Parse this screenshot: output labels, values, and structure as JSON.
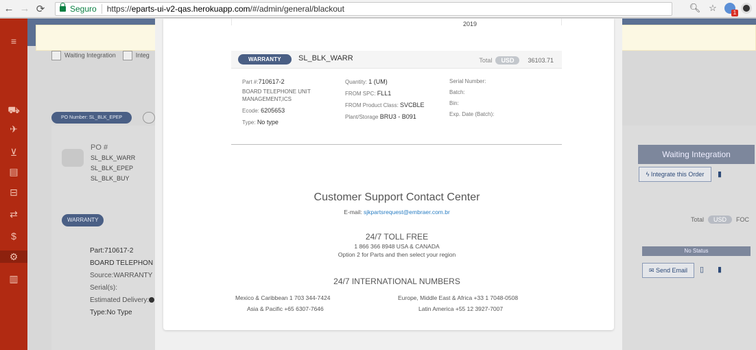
{
  "browser": {
    "secure_label": "Seguro",
    "url_prefix": "https://",
    "url_host": "eparts-ui-v2-qas.herokuapp.com",
    "url_path": "/#/admin/general/blackout",
    "ext_badge": "1"
  },
  "background": {
    "filters": [
      "Waiting Integration",
      "Integ"
    ],
    "po_chip": "PO Number: SL_BLK_EPEP",
    "po_title": "PO #",
    "po_numbers": [
      "SL_BLK_WARR",
      "SL_BLK_EPEP",
      "SL_BLK_BUY"
    ],
    "status_button": "Waiting Integration",
    "integrate_button": "Integrate this Order",
    "warranty_chip": "WARRANTY",
    "total_label": "Total",
    "currency": "USD",
    "foc": "FOC",
    "part_lines": [
      "Part:710617-2",
      "BOARD TELEPHON",
      "Source:WARRANTY",
      "Serial(s):",
      "Estimated Delivery:",
      "Type:No Type"
    ],
    "no_status": "No Status",
    "send_email": "Send Email"
  },
  "modal": {
    "year": "2019",
    "item": {
      "warranty_chip": "WARRANTY",
      "code": "SL_BLK_WARR",
      "total_label": "Total",
      "currency": "USD",
      "total_value": "36103.71",
      "part_label": "Part #:",
      "part_value": "710617-2",
      "description": "BOARD TELEPHONE UNIT MANAGEMENT,ICS",
      "ecode_label": "Ecode:",
      "ecode_value": "6205653",
      "type_label": "Type:",
      "type_value": "No type",
      "quantity_label": "Quantity:",
      "quantity_value": "1 (UM)",
      "from_spc_label": "FROM SPC:",
      "from_spc_value": "FLL1",
      "from_class_label": "FROM Product Class:",
      "from_class_value": "SVCBLE",
      "plant_label": "Plant/Storage",
      "plant_value": "BRU3 - B091",
      "serial_label": "Serial Number:",
      "batch_label": "Batch:",
      "bin_label": "Bin:",
      "exp_label": "Exp. Date (Batch):"
    },
    "support": {
      "title": "Customer Support Contact Center",
      "email_label": "E-mail:",
      "email": "sjkpartsrequest@embraer.com.br",
      "tollfree_title": "24/7 TOLL FREE",
      "tollfree_number": "1 866 366 8948 USA & CANADA",
      "tollfree_option": "Option 2 for Parts and then select your region",
      "intl_title": "24/7 INTERNATIONAL NUMBERS",
      "mexico": "Mexico & Caribbean 1 703 344-7424",
      "europe": "Europe, Middle East & Africa +33 1 7048-0508",
      "asia": "Asia & Pacific +65 6307-7646",
      "latam": "Latin America +55 12 3927-7007"
    }
  }
}
